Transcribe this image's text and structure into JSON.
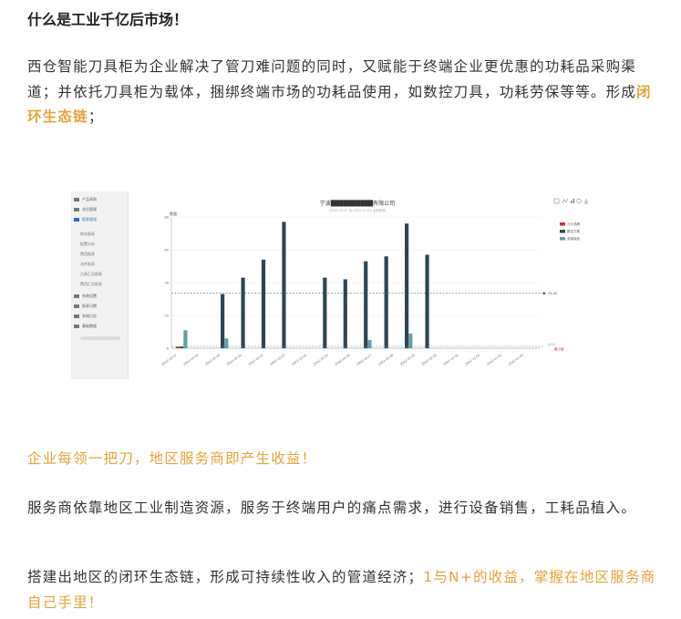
{
  "heading": "什么是工业千亿后市场！",
  "para1": {
    "text": "西仓智能刀具柜为企业解决了管刀难问题的同时，又赋能于终端企业更优惠的功耗品采购渠道；并依托刀具柜为载体，捆绑终端市场的功耗品使用，如数控刀具，功耗劳保等等。形成",
    "highlight": "闭环生态链",
    "tail": "；"
  },
  "screenshot": {
    "sidebar": [
      "产品采购",
      "仓位管理",
      "报表管理",
      "库存报表",
      "配置分析",
      "费用报表",
      "油井报表",
      "刀具汇总报表",
      "费用汇总报表",
      "系统设置",
      "报表日期",
      "系统日志",
      "基础数据"
    ],
    "toolbar_icons": [
      "data-view-icon",
      "line-chart-icon",
      "bar-chart-icon",
      "restore-icon",
      "download-icon"
    ]
  },
  "chart_data": {
    "type": "bar",
    "title": "宁波██████████有限公司",
    "subtitle": "2022-10-17 至 2022-11-03 全部数据",
    "ylabel": "数量",
    "ylim": [
      0,
      80
    ],
    "yticks": [
      0,
      20,
      40,
      60,
      80
    ],
    "categories": [
      "2022-10-17",
      "2022-10-18",
      "2022-10-19",
      "2022-10-20",
      "2022-10-21",
      "2022-10-22",
      "2022-10-23",
      "2022-10-24",
      "2022-10-25",
      "2022-10-26",
      "2022-10-27",
      "2022-10-28",
      "2022-10-29",
      "2022-10-30",
      "2022-10-31",
      "2022-11-01",
      "2022-11-02",
      "2022-11-03"
    ],
    "xtick_labels": [
      "2022-10-17",
      "2022-10-19",
      "2022-10-20",
      "2022-10-21",
      "2022-10-22",
      "2022-10-23",
      "2022-10-24",
      "2022-10-25",
      "2022-10-26",
      "2022-10-27",
      "2022-10-28",
      "2022-10-29",
      "2022-10-30",
      "2022-10-31",
      "2022-11-01",
      "2022-11-02",
      "2022-11-03"
    ],
    "series": [
      {
        "name": "刀片品牌",
        "color": "#c23531",
        "values": [
          1,
          0,
          0,
          0,
          0,
          0,
          0,
          0,
          0,
          0,
          0,
          0,
          0,
          0,
          0,
          0,
          0,
          0
        ]
      },
      {
        "name": "数控刀具",
        "color": "#2f4554",
        "values": [
          1,
          0,
          33,
          43,
          54,
          77,
          0,
          43,
          42,
          53,
          56,
          76,
          57,
          0,
          0,
          0,
          0,
          0
        ]
      },
      {
        "name": "劳保用品",
        "color": "#61a0a8",
        "values": [
          11,
          0,
          6,
          0,
          0,
          0,
          0,
          0,
          0,
          5,
          0,
          9,
          0,
          0,
          0,
          0,
          0,
          0
        ]
      }
    ],
    "markline_avg": {
      "value": 33.44,
      "label": "33.44"
    },
    "markline_min": {
      "value": 0,
      "label": "0.00"
    },
    "min_label": "最小值"
  },
  "slogan1": "企业每领一把刀，地区服务商即产生收益！",
  "para2": "服务商依靠地区工业制造资源，服务于终端用户的痛点需求，进行设备销售，工耗品植入。",
  "para3": {
    "text": "搭建出地区的闭环生态链，形成可持续性收入的管道经济；",
    "highlight": "1与N+的收益，掌握在地区服务商自己手里！"
  }
}
